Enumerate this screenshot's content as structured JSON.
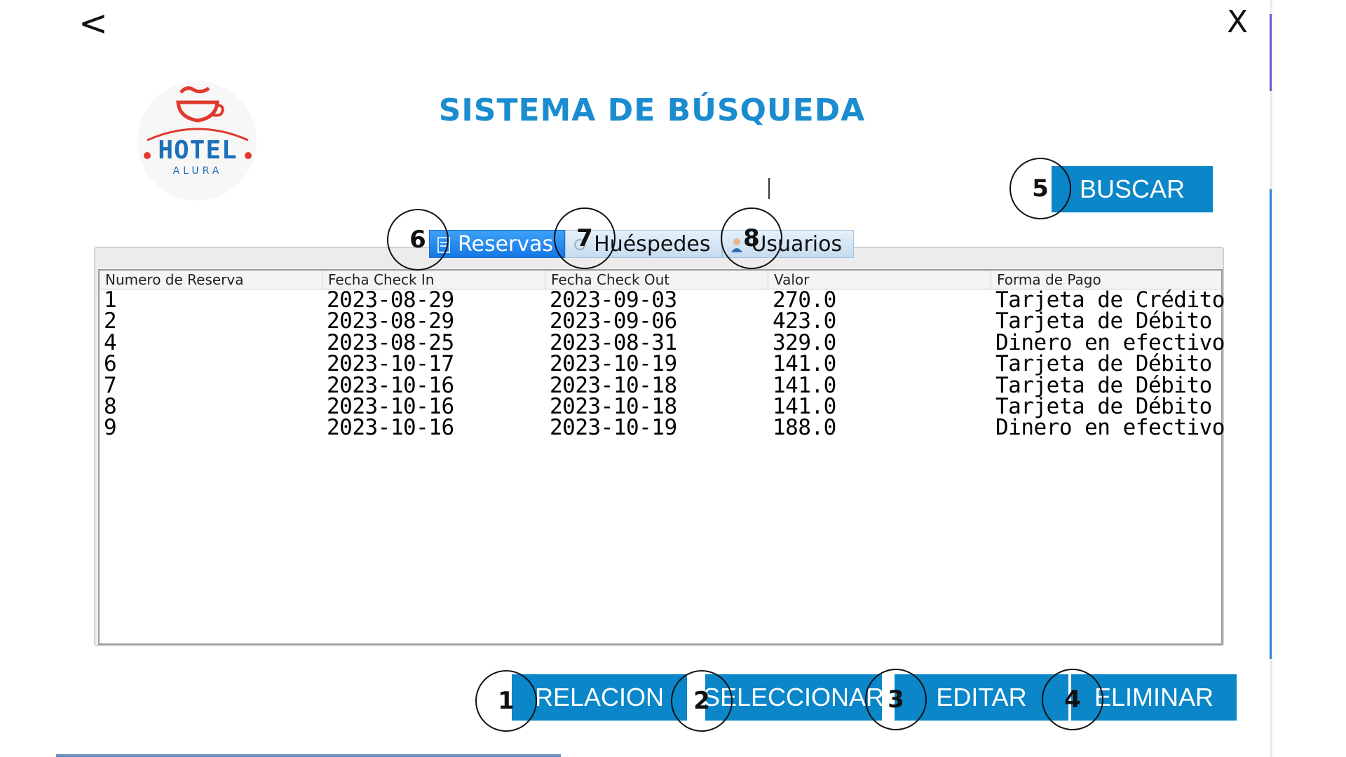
{
  "nav": {
    "back": "<",
    "close": "X"
  },
  "logo": {
    "brand": "HOTEL",
    "sub": "ALURA"
  },
  "title": "SISTEMA DE BÚSQUEDA",
  "search": {
    "button_label": "BUSCAR"
  },
  "tabs": [
    {
      "label": "Reservas",
      "active": true
    },
    {
      "label": "Huéspedes",
      "active": false
    },
    {
      "label": "Usuarios",
      "active": false
    }
  ],
  "table": {
    "headers": [
      "Numero de Reserva",
      "Fecha Check In",
      "Fecha Check Out",
      "Valor",
      "Forma de Pago"
    ],
    "rows": [
      [
        "1",
        "2023-08-29",
        "2023-09-03",
        "270.0",
        "Tarjeta de Crédito"
      ],
      [
        "2",
        "2023-08-29",
        "2023-09-06",
        "423.0",
        "Tarjeta de Débito"
      ],
      [
        "4",
        "2023-08-25",
        "2023-08-31",
        "329.0",
        "Dinero en efectivo"
      ],
      [
        "6",
        "2023-10-17",
        "2023-10-19",
        "141.0",
        "Tarjeta de Débito"
      ],
      [
        "7",
        "2023-10-16",
        "2023-10-18",
        "141.0",
        "Tarjeta de Débito"
      ],
      [
        "8",
        "2023-10-16",
        "2023-10-18",
        "141.0",
        "Tarjeta de Débito"
      ],
      [
        "9",
        "2023-10-16",
        "2023-10-19",
        "188.0",
        "Dinero en efectivo"
      ]
    ]
  },
  "actions": {
    "relacion": "RELACION",
    "seleccionar": "SELECCIONAR",
    "editar": "EDITAR",
    "eliminar": "ELIMINAR"
  },
  "markers": [
    "1",
    "2",
    "3",
    "4",
    "5",
    "6",
    "7",
    "8"
  ],
  "colors": {
    "accent": "#0a86c9",
    "title": "#1a8ccf",
    "tab_active": "#1477e6",
    "logo_red": "#e03a2e",
    "logo_blue": "#1c6fb8"
  }
}
